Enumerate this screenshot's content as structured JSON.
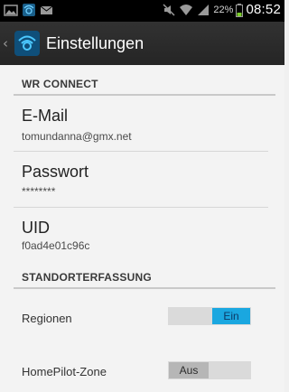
{
  "status_bar": {
    "icons_left": [
      "image-notification-icon",
      "app-notification-icon",
      "mail-notification-icon"
    ],
    "icons_right": [
      "mute-icon",
      "wifi-icon",
      "signal-icon"
    ],
    "battery_percent": "22%",
    "time": "08:52"
  },
  "action_bar": {
    "title": "Einstellungen",
    "accent_color": "#1aa7e0"
  },
  "sections": {
    "wr_connect": {
      "header": "WR CONNECT",
      "email": {
        "title": "E-Mail",
        "summary": "tomundanna@gmx.net"
      },
      "password": {
        "title": "Passwort",
        "summary": "********"
      },
      "uid": {
        "title": "UID",
        "summary": "f0ad4e01c96c"
      }
    },
    "standort": {
      "header": "STANDORTERFASSUNG",
      "regionen": {
        "label": "Regionen",
        "state": "Ein",
        "checked": true
      },
      "homepilot": {
        "label": "HomePilot-Zone",
        "state": "Aus",
        "checked": false
      }
    }
  },
  "colors": {
    "switch_on": "#1aa7e0",
    "switch_off": "#b6b6b6",
    "background": "#f3f3f3"
  }
}
